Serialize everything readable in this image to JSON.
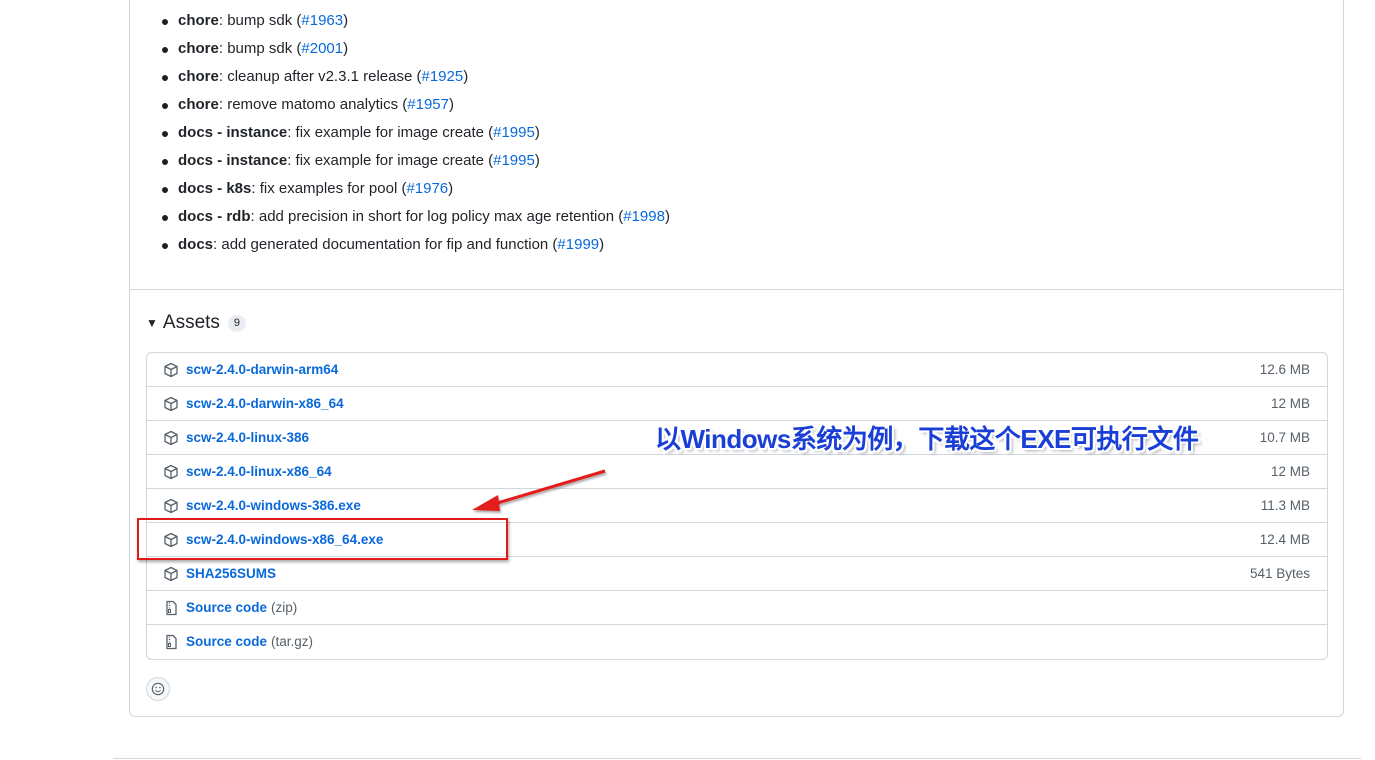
{
  "changelog": [
    {
      "prefix": "chore",
      "text": ": bump sdk (",
      "issue": "#1963",
      "suffix": ")"
    },
    {
      "prefix": "chore",
      "text": ": bump sdk (",
      "issue": "#2001",
      "suffix": ")"
    },
    {
      "prefix": "chore",
      "text": ": cleanup after v2.3.1 release (",
      "issue": "#1925",
      "suffix": ")"
    },
    {
      "prefix": "chore",
      "text": ": remove matomo analytics (",
      "issue": "#1957",
      "suffix": ")"
    },
    {
      "prefix": "docs - instance",
      "text": ": fix example for image create (",
      "issue": "#1995",
      "suffix": ")"
    },
    {
      "prefix": "docs - instance",
      "text": ": fix example for image create (",
      "issue": "#1995",
      "suffix": ")"
    },
    {
      "prefix": "docs - k8s",
      "text": ": fix examples for pool (",
      "issue": "#1976",
      "suffix": ")"
    },
    {
      "prefix": "docs - rdb",
      "text": ": add precision in short for log policy max age retention (",
      "issue": "#1998",
      "suffix": ")"
    },
    {
      "prefix": "docs",
      "text": ": add generated documentation for fip and function (",
      "issue": "#1999",
      "suffix": ")"
    }
  ],
  "assets": {
    "title": "Assets",
    "count": "9",
    "items": [
      {
        "name": "scw-2.4.0-darwin-arm64",
        "format": "",
        "size": "12.6 MB",
        "icon": "package-icon"
      },
      {
        "name": "scw-2.4.0-darwin-x86_64",
        "format": "",
        "size": "12 MB",
        "icon": "package-icon"
      },
      {
        "name": "scw-2.4.0-linux-386",
        "format": "",
        "size": "10.7 MB",
        "icon": "package-icon"
      },
      {
        "name": "scw-2.4.0-linux-x86_64",
        "format": "",
        "size": "12 MB",
        "icon": "package-icon"
      },
      {
        "name": "scw-2.4.0-windows-386.exe",
        "format": "",
        "size": "11.3 MB",
        "icon": "package-icon"
      },
      {
        "name": "scw-2.4.0-windows-x86_64.exe",
        "format": "",
        "size": "12.4 MB",
        "icon": "package-icon"
      },
      {
        "name": "SHA256SUMS",
        "format": "",
        "size": "541 Bytes",
        "icon": "package-icon"
      },
      {
        "name": "Source code",
        "format": "(zip)",
        "size": "",
        "icon": "file-zip-icon"
      },
      {
        "name": "Source code",
        "format": "(tar.gz)",
        "size": "",
        "icon": "file-zip-icon"
      }
    ]
  },
  "annotation": {
    "text": "以Windows系统为例，下载这个EXE可执行文件",
    "color": "#1a3fd6",
    "highlight_color": "#e31a1a"
  },
  "colors": {
    "link": "#0969da",
    "border": "#d0d7de",
    "muted": "#57606a"
  }
}
